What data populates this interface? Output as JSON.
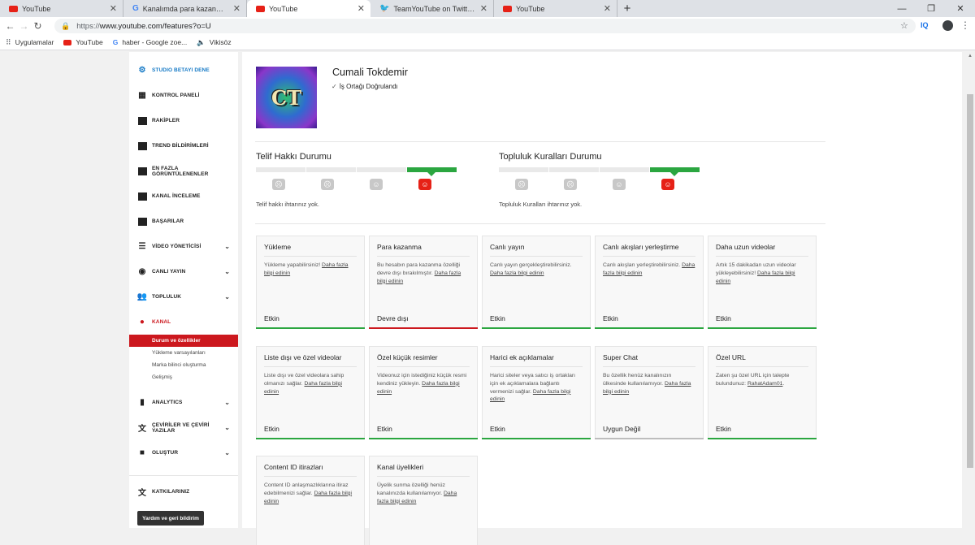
{
  "browser": {
    "tabs": [
      {
        "title": "YouTube",
        "icon": "youtube-icon"
      },
      {
        "title": "Kanalımda para kazanma özelliği",
        "icon": "google-icon"
      },
      {
        "title": "YouTube",
        "icon": "youtube-icon"
      },
      {
        "title": "TeamYouTube on Twitter: \"Hi the",
        "icon": "twitter-icon"
      },
      {
        "title": "YouTube",
        "icon": "youtube-icon"
      }
    ],
    "active_tab_index": 2,
    "url_protocol": "https://",
    "url_rest": "www.youtube.com/features?o=U",
    "bookmarks": [
      "Uygulamalar",
      "YouTube",
      "haber - Google zoe...",
      "Vikisöz"
    ],
    "extension_label": "IQ"
  },
  "sidebar": {
    "studio_beta": "STUDIO BETAYI DENE",
    "items": [
      "KONTROL PANELİ",
      "RAKİPLER",
      "TREND BİLDİRİMLERİ",
      "EN FAZLA GÖRÜNTÜLENENLER",
      "KANAL İNCELEME",
      "BAŞARILAR",
      "VİDEO YÖNETİCİSİ",
      "CANLI YAYIN",
      "TOPLULUK",
      "KANAL"
    ],
    "sub_items": [
      "Durum ve özellikler",
      "Yükleme varsayılanları",
      "Marka bilinci oluşturma",
      "Gelişmiş"
    ],
    "items2": [
      "ANALYTICS",
      "ÇEVİRİLER VE ÇEVİRİ YAZILAR",
      "OLUŞTUR"
    ],
    "contributions": "KATKILARINIZ",
    "feedback": "Yardım ve geri bildirim"
  },
  "channel": {
    "name": "Cumali Tokdemir",
    "verified_text": "İş Ortağı Doğrulandı",
    "avatar_text": "CT"
  },
  "copyright": {
    "title": "Telif Hakkı Durumu",
    "message": "Telif hakkı ihtarınız yok.",
    "level": 4
  },
  "community": {
    "title": "Topluluk Kuralları Durumu",
    "message": "Topluluk Kuralları ihtarınız yok.",
    "level": 4
  },
  "features": [
    {
      "title": "Yükleme",
      "desc": "Yükleme yapabilirsiniz!",
      "link": "Daha fazla bilgi edinin",
      "status": "Etkin",
      "state": "green"
    },
    {
      "title": "Para kazanma",
      "desc": "Bu hesabın para kazanma özelliği devre dışı bırakılmıştır.",
      "link": "Daha fazla bilgi edinin",
      "status": "Devre dışı",
      "state": "red"
    },
    {
      "title": "Canlı yayın",
      "desc": "Canlı yayın gerçekleştirebilirsiniz.",
      "link": "Daha fazla bilgi edinin",
      "status": "Etkin",
      "state": "green"
    },
    {
      "title": "Canlı akışları yerleştirme",
      "desc": "Canlı akışları yerleştirebilirsiniz.",
      "link": "Daha fazla bilgi edinin",
      "status": "Etkin",
      "state": "green"
    },
    {
      "title": "Daha uzun videolar",
      "desc": "Artık 15 dakikadan uzun videolar yükleyebilirsiniz!",
      "link": "Daha fazla bilgi edinin",
      "status": "Etkin",
      "state": "green"
    },
    {
      "title": "Liste dışı ve özel videolar",
      "desc": "Liste dışı ve özel videolara sahip olmanızı sağlar.",
      "link": "Daha fazla bilgi edinin",
      "status": "Etkin",
      "state": "green"
    },
    {
      "title": "Özel küçük resimler",
      "desc": "Videonuz için istediğiniz küçük resmi kendiniz yükleyin.",
      "link": "Daha fazla bilgi edinin",
      "status": "Etkin",
      "state": "green"
    },
    {
      "title": "Harici ek açıklamalar",
      "desc": "Harici siteler veya satıcı iş ortakları için ek açıklamalara bağlantı vermenizi sağlar.",
      "link": "Daha fazla bilgi edinin",
      "status": "Etkin",
      "state": "green"
    },
    {
      "title": "Super Chat",
      "desc": "Bu özellik henüz kanalınızın ülkesinde kullanılamıyor.",
      "link": "Daha fazla bilgi edinin",
      "status": "Uygun Değil",
      "state": "grey"
    },
    {
      "title": "Özel URL",
      "desc": "Zaten şu özel URL için talepte bulundunuz:",
      "link": "RahatAdam01",
      "suffix": ".",
      "status": "Etkin",
      "state": "green"
    },
    {
      "title": "Content ID itirazları",
      "desc": "Content ID anlaşmazlıklarına itiraz edebilmenizi sağlar.",
      "link": "Daha fazla bilgi edinin",
      "status": "",
      "state": "none"
    },
    {
      "title": "Kanal üyelikleri",
      "desc": "Üyelik sunma özelliği henüz kanalınızda kullanılamıyor.",
      "link": "Daha fazla bilgi edinin",
      "status": "",
      "state": "none"
    }
  ]
}
